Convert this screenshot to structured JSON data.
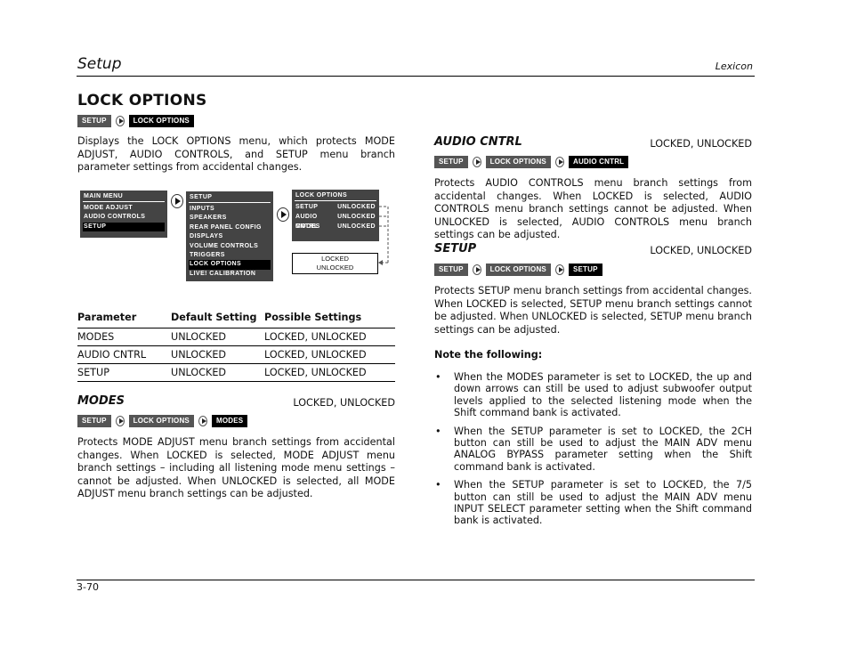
{
  "header": {
    "section_title": "Setup",
    "brand": "Lexicon"
  },
  "page": {
    "heading": "LOCK OPTIONS",
    "breadcrumb": [
      "SETUP",
      "LOCK OPTIONS"
    ],
    "intro": "Displays the LOCK OPTIONS menu, which protects MODE ADJUST, AUDIO CONTROLS, and SETUP menu branch parameter settings from accidental changes.",
    "page_number": "3-70"
  },
  "diagram": {
    "main_menu": {
      "title": "MAIN MENU",
      "items": [
        "MODE ADJUST",
        "AUDIO CONTROLS",
        "SETUP"
      ],
      "selected": "SETUP"
    },
    "setup_menu": {
      "title": "SETUP",
      "items": [
        "INPUTS",
        "SPEAKERS",
        "REAR PANEL CONFIG",
        "DISPLAYS",
        "VOLUME CONTROLS",
        "TRIGGERS",
        "LOCK OPTIONS",
        "LIVE! CALIBRATION"
      ],
      "selected": "LOCK OPTIONS"
    },
    "lock_menu": {
      "title": "LOCK OPTIONS",
      "rows": [
        {
          "param": "SETUP",
          "value": "UNLOCKED"
        },
        {
          "param": "AUDIO CNTRL",
          "value": "UNLOCKED"
        },
        {
          "param": "MODES",
          "value": "UNLOCKED"
        }
      ]
    },
    "options_box": [
      "LOCKED",
      "UNLOCKED"
    ]
  },
  "table": {
    "headers": [
      "Parameter",
      "Default Setting",
      "Possible Settings"
    ],
    "rows": [
      [
        "MODES",
        "UNLOCKED",
        "LOCKED, UNLOCKED"
      ],
      [
        "AUDIO CNTRL",
        "UNLOCKED",
        "LOCKED, UNLOCKED"
      ],
      [
        "SETUP",
        "UNLOCKED",
        "LOCKED, UNLOCKED"
      ]
    ]
  },
  "sections": {
    "modes": {
      "title": "MODES",
      "settings": "LOCKED, UNLOCKED",
      "breadcrumb": [
        "SETUP",
        "LOCK OPTIONS",
        "MODES"
      ],
      "body": "Protects MODE ADJUST menu branch settings from accidental changes. When LOCKED is selected, MODE ADJUST menu branch settings – including all listening mode menu settings – cannot be adjusted. When UNLOCKED is selected, all MODE ADJUST menu branch settings can be adjusted."
    },
    "audio_cntrl": {
      "title": "AUDIO CNTRL",
      "settings": "LOCKED, UNLOCKED",
      "breadcrumb": [
        "SETUP",
        "LOCK OPTIONS",
        "AUDIO CNTRL"
      ],
      "body": "Protects AUDIO CONTROLS menu branch settings from accidental changes. When LOCKED is selected, AUDIO CONTROLS menu branch settings cannot be adjusted. When UNLOCKED is selected, AUDIO CONTROLS menu branch settings can be adjusted."
    },
    "setup": {
      "title": "SETUP",
      "settings": "LOCKED, UNLOCKED",
      "breadcrumb": [
        "SETUP",
        "LOCK OPTIONS",
        "SETUP"
      ],
      "body": "Protects SETUP menu branch settings from accidental changes. When LOCKED is selected, SETUP menu branch settings cannot be adjusted. When UNLOCKED is selected, SETUP menu branch settings can be adjusted."
    }
  },
  "notes": {
    "title": "Note the following:",
    "bullet": "•",
    "items": [
      "When the MODES parameter is set to LOCKED, the up and down arrows can still be used to adjust subwoofer output levels applied to the selected listening mode when the Shift command bank is activated.",
      "When the SETUP parameter is set to LOCKED, the 2CH button can still be used to adjust the MAIN ADV menu ANALOG BYPASS parameter setting when the Shift command bank is activated.",
      "When the SETUP parameter is set to LOCKED, the 7/5 button can still be used to adjust the MAIN ADV menu INPUT SELECT parameter setting when the Shift command bank is activated."
    ]
  }
}
